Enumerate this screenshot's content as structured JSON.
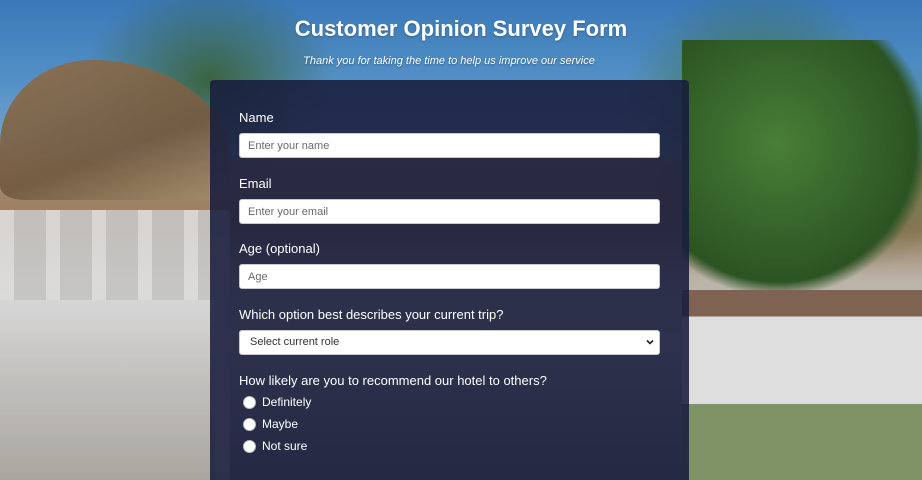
{
  "header": {
    "title": "Customer Opinion Survey Form",
    "subtitle": "Thank you for taking the time to help us improve our service"
  },
  "form": {
    "name": {
      "label": "Name",
      "placeholder": "Enter your name"
    },
    "email": {
      "label": "Email",
      "placeholder": "Enter your email"
    },
    "age": {
      "label": "Age (optional)",
      "placeholder": "Age"
    },
    "trip": {
      "label": "Which option best describes your current trip?",
      "selected": "Select current role"
    },
    "recommend": {
      "label": "How likely are you to recommend our hotel to others?",
      "options": [
        "Definitely",
        "Maybe",
        "Not sure"
      ]
    }
  },
  "colors": {
    "panel": "#181c3c",
    "text": "#ffffff"
  }
}
